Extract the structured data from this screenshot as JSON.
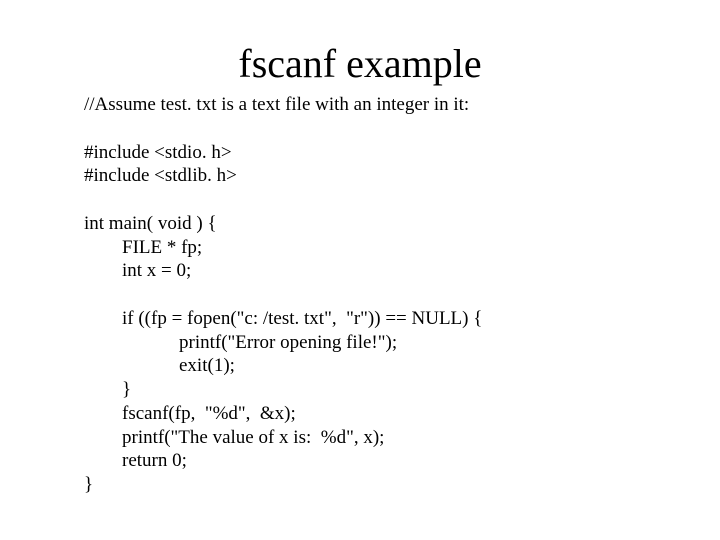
{
  "title": "fscanf example",
  "lines": {
    "l0": "//Assume test. txt is a text file with an integer in it:",
    "l1": "",
    "l2": "#include <stdio. h>",
    "l3": "#include <stdlib. h>",
    "l4": "",
    "l5": "int main( void ) {",
    "l6": "        FILE * fp;",
    "l7": "        int x = 0;",
    "l8": "",
    "l9": "        if ((fp = fopen(\"c: /test. txt\",  \"r\")) == NULL) {",
    "l10": "                    printf(\"Error opening file!\");",
    "l11": "                    exit(1);",
    "l12": "        }",
    "l13": "        fscanf(fp,  \"%d\",  &x);",
    "l14": "        printf(\"The value of x is:  %d\", x);",
    "l15": "        return 0;",
    "l16": "}"
  }
}
